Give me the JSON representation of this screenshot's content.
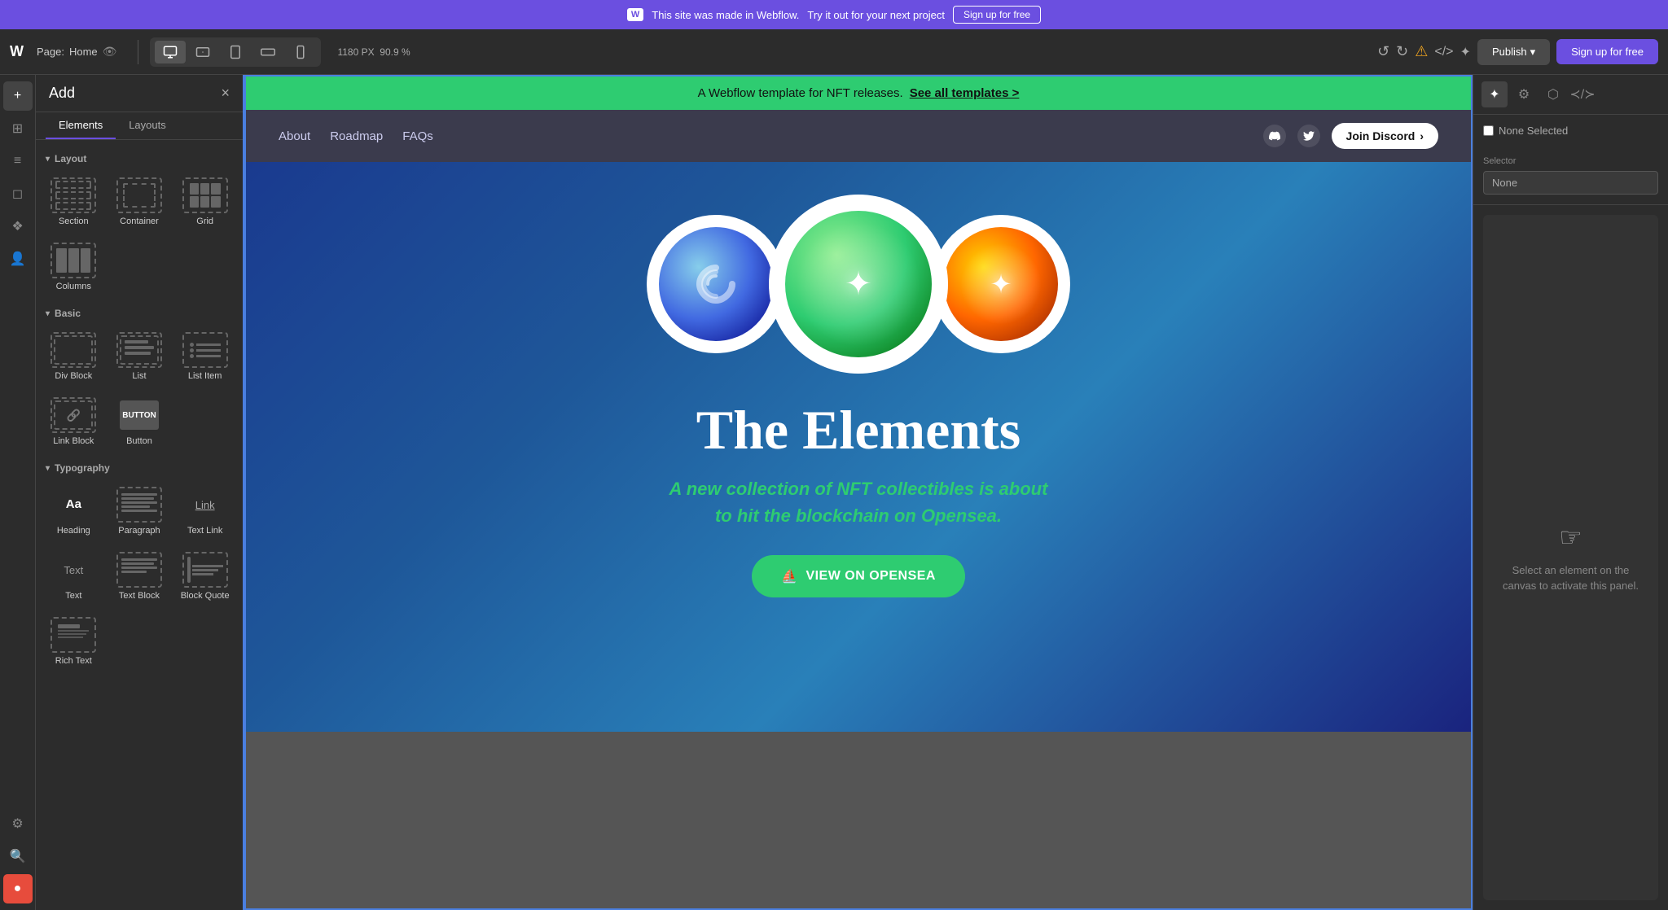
{
  "top_banner": {
    "logo": "W",
    "text": "This site was made in Webflow.",
    "subtext": "Try it out for your next project",
    "cta": "Sign up for free"
  },
  "toolbar": {
    "logo": "W",
    "page_label": "Page:",
    "page_name": "Home",
    "dimension": "1180 PX",
    "zoom": "90.9 %",
    "publish_label": "Publish",
    "signup_label": "Sign up for free",
    "viewport_buttons": [
      "desktop",
      "tablet_landscape",
      "tablet_portrait",
      "mobile_landscape",
      "mobile"
    ]
  },
  "add_panel": {
    "title": "Add",
    "close_icon": "×",
    "tabs": [
      "Elements",
      "Layouts"
    ],
    "sections": {
      "layout": {
        "label": "Layout",
        "items": [
          "Section",
          "Container",
          "Grid",
          "Columns"
        ]
      },
      "basic": {
        "label": "Basic",
        "items": [
          "Div Block",
          "List",
          "List Item",
          "Link Block",
          "Button"
        ]
      },
      "typography": {
        "label": "Typography",
        "items": [
          "Heading",
          "Paragraph",
          "Text Link",
          "Text",
          "Text Block",
          "Block Quote",
          "Rich Text"
        ]
      }
    }
  },
  "left_sidebar": {
    "icons": [
      "add",
      "pages",
      "layers",
      "assets",
      "components",
      "users",
      "settings",
      "search"
    ]
  },
  "site_banner": {
    "text": "A Webflow template for NFT releases.",
    "link_text": "See all templates >"
  },
  "site_nav": {
    "links": [
      "About",
      "Roadmap",
      "FAQs"
    ],
    "discord_btn": "Join Discord",
    "chevron": "›"
  },
  "hero": {
    "title": "The Elements",
    "subtitle_plain1": "A",
    "subtitle_em": "new collection of NFT collectibles",
    "subtitle_plain2": "is about to hit the blockchain on Opensea.",
    "cta_label": "VIEW ON OPENSEA",
    "cta_icon": "⛵"
  },
  "right_panel": {
    "none_selected_label": "None Selected",
    "selector_label": "Selector",
    "selector_placeholder": "None",
    "prompt_text": "Select an element on the canvas to activate this panel.",
    "cursor_icon": "☞"
  }
}
